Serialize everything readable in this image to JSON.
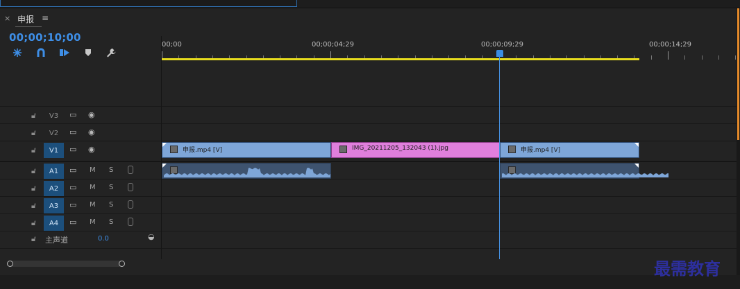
{
  "panel": {
    "close_glyph": "×",
    "title": "申报",
    "menu_glyph": "≡"
  },
  "timecode": "00;00;10;00",
  "toolbar": [
    "snap-icon",
    "linked-selection-icon",
    "add-marker-icon",
    "marker-icon",
    "wrench-settings-icon"
  ],
  "ruler": {
    "labels": [
      "00;00",
      "00;00;04;29",
      "00;00;09;29",
      "00;00;14;29"
    ]
  },
  "playhead_time": "00;00;09;29",
  "tracks": {
    "video": [
      {
        "name": "V3",
        "targeted": false
      },
      {
        "name": "V2",
        "targeted": false
      },
      {
        "name": "V1",
        "targeted": true
      }
    ],
    "audio": [
      {
        "name": "A1",
        "m": "M",
        "s": "S"
      },
      {
        "name": "A2",
        "m": "M",
        "s": "S"
      },
      {
        "name": "A3",
        "m": "M",
        "s": "S"
      },
      {
        "name": "A4",
        "m": "M",
        "s": "S"
      }
    ]
  },
  "clips": {
    "v1": [
      {
        "label": "申报.mp4 [V]",
        "type": "video"
      },
      {
        "label": "IMG_20211205_132043 (1).jpg",
        "type": "image"
      },
      {
        "label": "申报.mp4 [V]",
        "type": "video"
      }
    ]
  },
  "master": {
    "label": "主声道",
    "value": "0.0"
  },
  "watermark": "最需教育",
  "colors": {
    "accent": "#3e8ee6",
    "video_clip": "#7ea6d8",
    "image_clip": "#e07fdc",
    "audio_clip": "#3e536f",
    "work_area": "#e7dc1e"
  }
}
